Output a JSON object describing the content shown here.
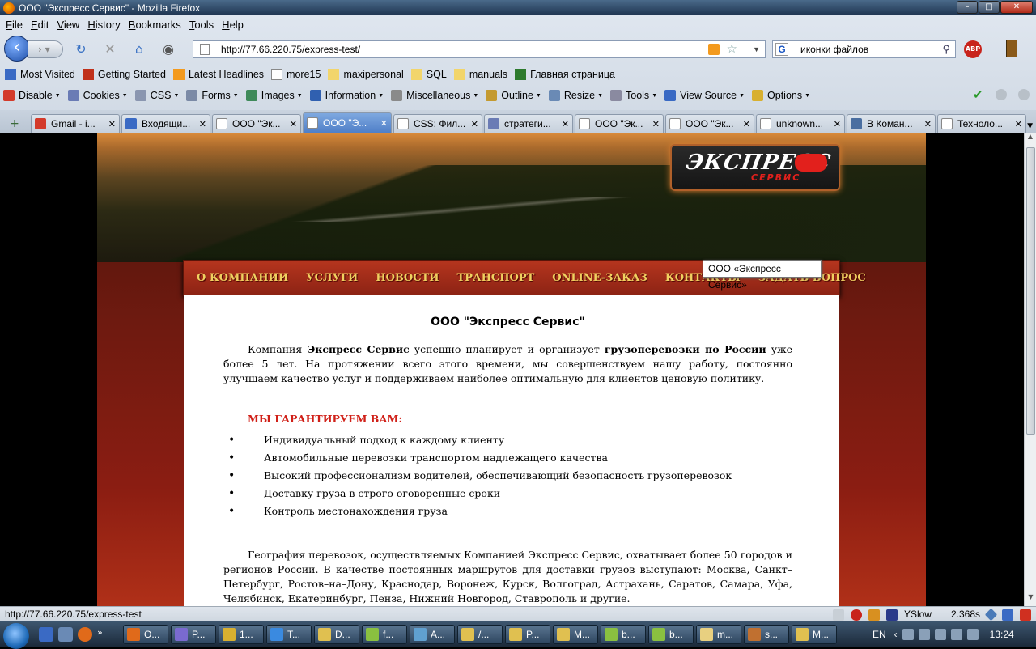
{
  "window": {
    "title": "ООО \"Экспресс Сервис\" - Mozilla Firefox"
  },
  "menubar": [
    "File",
    "Edit",
    "View",
    "History",
    "Bookmarks",
    "Tools",
    "Help"
  ],
  "nav": {
    "url": "http://77.66.220.75/express-test/",
    "search_value": "иконки файлов"
  },
  "bookmarks": [
    {
      "label": "Most Visited",
      "icon": "most-visited-icon",
      "color": "#3a6ac4"
    },
    {
      "label": "Getting Started",
      "icon": "firefox-icon",
      "color": "#c0301a"
    },
    {
      "label": "Latest Headlines",
      "icon": "rss-icon",
      "color": "#f39a1e"
    },
    {
      "label": "more15",
      "icon": "page-icon",
      "color": "#ffffff"
    },
    {
      "label": "maxipersonal",
      "icon": "folder-icon",
      "color": "#f2d56b"
    },
    {
      "label": "SQL",
      "icon": "folder-icon",
      "color": "#f2d56b"
    },
    {
      "label": "manuals",
      "icon": "folder-icon",
      "color": "#f2d56b"
    },
    {
      "label": "Главная страница",
      "icon": "wiki-icon",
      "color": "#2d7a2d"
    }
  ],
  "webdev": [
    {
      "label": "Disable",
      "icon": "disable-icon",
      "color": "#d33a2a"
    },
    {
      "label": "Cookies",
      "icon": "cookies-icon",
      "color": "#6a7bb5"
    },
    {
      "label": "CSS",
      "icon": "css-icon",
      "color": "#8a96b0"
    },
    {
      "label": "Forms",
      "icon": "forms-icon",
      "color": "#7b8aa6"
    },
    {
      "label": "Images",
      "icon": "images-icon",
      "color": "#3f8a5a"
    },
    {
      "label": "Information",
      "icon": "information-icon",
      "color": "#3060b0"
    },
    {
      "label": "Miscellaneous",
      "icon": "misc-icon",
      "color": "#8a8a8a"
    },
    {
      "label": "Outline",
      "icon": "outline-icon",
      "color": "#c49a30"
    },
    {
      "label": "Resize",
      "icon": "resize-icon",
      "color": "#6a8ab5"
    },
    {
      "label": "Tools",
      "icon": "tools-icon",
      "color": "#8a8aa0"
    },
    {
      "label": "View Source",
      "icon": "view-source-icon",
      "color": "#3a6ac4"
    },
    {
      "label": "Options",
      "icon": "options-icon",
      "color": "#d8b030"
    }
  ],
  "tabs": [
    {
      "label": "Gmail - i...",
      "icon": "gmail-icon",
      "color": "#d33a2a",
      "active": false
    },
    {
      "label": "Входящи...",
      "icon": "mail-icon",
      "color": "#3a6ac4",
      "active": false
    },
    {
      "label": "ООО \"Эк...",
      "icon": "page-icon",
      "color": "#ffffff",
      "active": false
    },
    {
      "label": "ООО \"Э...",
      "icon": "page-icon",
      "color": "#ffffff",
      "active": true
    },
    {
      "label": "CSS: Фил...",
      "icon": "page-icon",
      "color": "#ffffff",
      "active": false
    },
    {
      "label": "стратеги...",
      "icon": "link-icon",
      "color": "#6a7bb5",
      "active": false
    },
    {
      "label": "ООО \"Эк...",
      "icon": "page-icon",
      "color": "#ffffff",
      "active": false
    },
    {
      "label": "ООО \"Эк...",
      "icon": "page-icon",
      "color": "#ffffff",
      "active": false
    },
    {
      "label": "unknown...",
      "icon": "page-icon",
      "color": "#ffffff",
      "active": false
    },
    {
      "label": "В Коман...",
      "icon": "vk-icon",
      "color": "#4a6ea0",
      "active": false
    },
    {
      "label": "Техноло...",
      "icon": "page-icon",
      "color": "#ffffff",
      "active": false
    }
  ],
  "site": {
    "logo_main": "ЭКСПРЕСС",
    "logo_sub": "СЕРВИС",
    "menu": [
      "О КОМПАНИИ",
      "УСЛУГИ",
      "НОВОСТИ",
      "ТРАНСПОРТ",
      "ONLINE-ЗАКАЗ",
      "КОНТАКТЫ",
      "ЗАДАТЬ ВОПРОС"
    ],
    "tooltip": "ООО «Экспресс Сервис»",
    "title": "ООО \"Экспресс Сервис\"",
    "intro_p1": "Компания ",
    "intro_b1": "Экспресс Сервис",
    "intro_p2": " успешно планирует и организует ",
    "intro_b2": "грузоперевозки по России",
    "intro_p3": " уже более 5 лет. На протяжении всего этого времени, мы совершенствуем нашу работу, постоянно улучшаем качество услуг и поддерживаем наиболее оптимальную для клиентов ценовую политику.",
    "guarantee_heading": "МЫ ГАРАНТИРУЕМ ВАМ:",
    "guarantees": [
      "Индивидуальный подход к каждому клиенту",
      "Автомобильные перевозки транспортом надлежащего качества",
      "Высокий профессионализм водителей, обеспечивающий безопасность грузоперевозок",
      "Доставку груза в строго оговоренные сроки",
      "Контроль местонахождения груза"
    ],
    "geography": "География перевозок, осуществляемых Компанией Экспресс Сервис, охватывает более 50 городов и регионов России. В качестве постоянных маршрутов для доставки грузов выступают: Москва, Санкт–Петербург, Ростов–на–Дону, Краснодар, Воронеж, Курск, Волгоград, Астрахань, Саратов, Самара, Уфа, Челябинск, Екатеринбург, Пенза, Нижний Новгород, Ставрополь и другие."
  },
  "status": {
    "text": "http://77.66.220.75/express-test",
    "yslow": "YSlow",
    "time": "2.368s"
  },
  "taskbar": {
    "buttons": [
      {
        "label": "O...",
        "color": "#e06a1a"
      },
      {
        "label": "P...",
        "color": "#7a6ad0"
      },
      {
        "label": "1...",
        "color": "#d8b030"
      },
      {
        "label": "T...",
        "color": "#3a8ae0"
      },
      {
        "label": "D...",
        "color": "#e0c050"
      },
      {
        "label": "f...",
        "color": "#8ac040"
      },
      {
        "label": "A...",
        "color": "#60a0d0"
      },
      {
        "label": "/...",
        "color": "#e0c050"
      },
      {
        "label": "P...",
        "color": "#e0c050"
      },
      {
        "label": "M...",
        "color": "#e0c050"
      },
      {
        "label": "b...",
        "color": "#8ac040"
      },
      {
        "label": "b...",
        "color": "#8ac040"
      },
      {
        "label": "m...",
        "color": "#e8d080"
      },
      {
        "label": "s...",
        "color": "#c07030"
      },
      {
        "label": "M...",
        "color": "#e0c050"
      }
    ],
    "lang": "EN",
    "clock": "13:24"
  }
}
